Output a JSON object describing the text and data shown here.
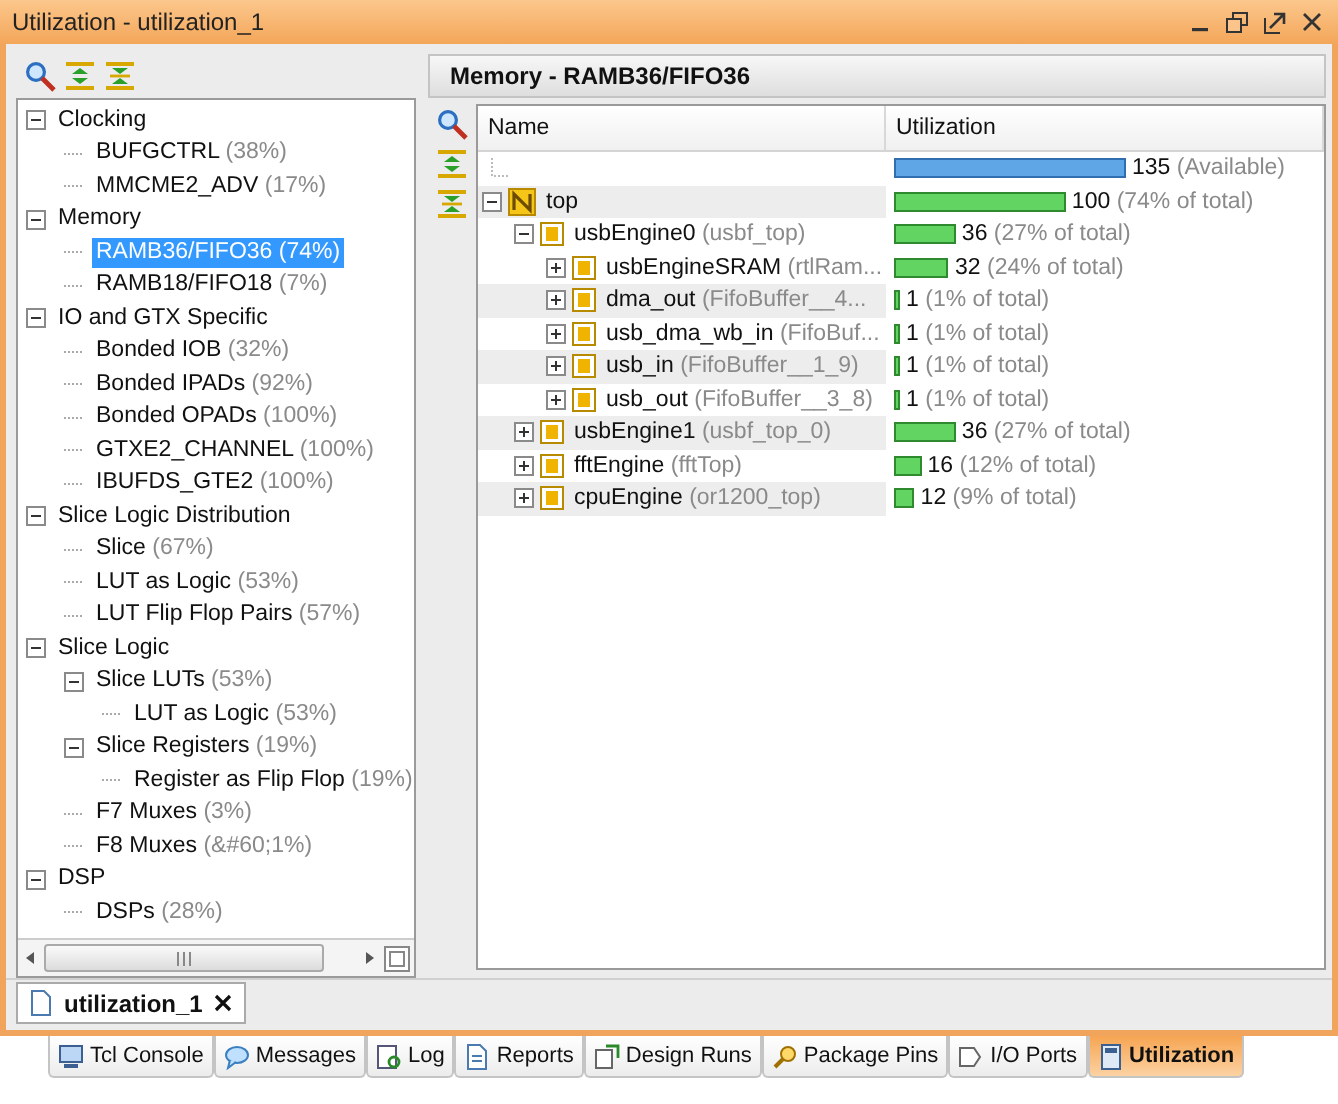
{
  "window": {
    "title": "Utilization - utilization_1"
  },
  "tree": [
    {
      "label": "Clocking",
      "selected": false,
      "expanded": true,
      "children": [
        {
          "label": "BUFGCTRL",
          "detail": "(38%)",
          "selected": false
        },
        {
          "label": "MMCME2_ADV",
          "detail": "(17%)",
          "selected": false
        }
      ]
    },
    {
      "label": "Memory",
      "selected": false,
      "expanded": true,
      "children": [
        {
          "label": "RAMB36/FIFO36",
          "detail": "(74%)",
          "selected": true
        },
        {
          "label": "RAMB18/FIFO18",
          "detail": "(7%)",
          "selected": false
        }
      ]
    },
    {
      "label": "IO and GTX Specific",
      "selected": false,
      "expanded": true,
      "children": [
        {
          "label": "Bonded IOB",
          "detail": "(32%)",
          "selected": false
        },
        {
          "label": "Bonded IPADs",
          "detail": "(92%)",
          "selected": false
        },
        {
          "label": "Bonded OPADs",
          "detail": "(100%)",
          "selected": false
        },
        {
          "label": "GTXE2_CHANNEL",
          "detail": "(100%)",
          "selected": false
        },
        {
          "label": "IBUFDS_GTE2",
          "detail": "(100%)",
          "selected": false
        }
      ]
    },
    {
      "label": "Slice Logic Distribution",
      "selected": false,
      "expanded": true,
      "children": [
        {
          "label": "Slice",
          "detail": "(67%)",
          "selected": false
        },
        {
          "label": "LUT as Logic",
          "detail": "(53%)",
          "selected": false
        },
        {
          "label": "LUT Flip Flop Pairs",
          "detail": "(57%)",
          "selected": false
        }
      ]
    },
    {
      "label": "Slice Logic",
      "selected": false,
      "expanded": true,
      "children": [
        {
          "label": "Slice LUTs",
          "detail": "(53%)",
          "selected": false,
          "expanded": true,
          "children": [
            {
              "label": "LUT as Logic",
              "detail": "(53%)",
              "selected": false
            }
          ]
        },
        {
          "label": "Slice Registers",
          "detail": "(19%)",
          "selected": false,
          "expanded": true,
          "children": [
            {
              "label": "Register as Flip Flop",
              "detail": "(19%)",
              "selected": false
            }
          ]
        },
        {
          "label": "F7 Muxes",
          "detail": "(3%)",
          "selected": false
        },
        {
          "label": "F8 Muxes",
          "detail": "(&#60;1%)",
          "selected": false
        }
      ]
    },
    {
      "label": "DSP",
      "selected": false,
      "expanded": true,
      "children": [
        {
          "label": "DSPs",
          "detail": "(28%)",
          "selected": false
        }
      ]
    }
  ],
  "panel": {
    "title": "Memory - RAMB36/FIFO36"
  },
  "table": {
    "columns": [
      "Name",
      "Utilization"
    ],
    "rows": [
      {
        "kind": "available",
        "value": "135",
        "note": "(Available)",
        "color": "#5ea6e6"
      },
      {
        "kind": "top",
        "name": "top",
        "expanded": true,
        "value": "100",
        "note": "(74% of total)",
        "color": "#62d462",
        "children": [
          {
            "kind": "module",
            "name": "usbEngine0",
            "detail": "(usbf_top)",
            "expanded": true,
            "value": "36",
            "note": "(27% of total)",
            "color": "#62d462",
            "children": [
              {
                "kind": "module",
                "name": "usbEngineSRAM",
                "detail": "(rtlRam...",
                "expanded": false,
                "value": "32",
                "note": "(24% of total)",
                "color": "#62d462"
              },
              {
                "kind": "module",
                "name": "dma_out",
                "detail": "(FifoBuffer__4...",
                "expanded": false,
                "value": "1",
                "note": "(1% of total)",
                "color": "#62d462"
              },
              {
                "kind": "module",
                "name": "usb_dma_wb_in",
                "detail": "(FifoBuf...",
                "expanded": false,
                "value": "1",
                "note": "(1% of total)",
                "color": "#62d462"
              },
              {
                "kind": "module",
                "name": "usb_in",
                "detail": "(FifoBuffer__1_9)",
                "expanded": false,
                "value": "1",
                "note": "(1% of total)",
                "color": "#62d462"
              },
              {
                "kind": "module",
                "name": "usb_out",
                "detail": "(FifoBuffer__3_8)",
                "expanded": false,
                "value": "1",
                "note": "(1% of total)",
                "color": "#62d462"
              }
            ]
          },
          {
            "kind": "module",
            "name": "usbEngine1",
            "detail": "(usbf_top_0)",
            "expanded": false,
            "value": "36",
            "note": "(27% of total)",
            "color": "#62d462"
          },
          {
            "kind": "module",
            "name": "fftEngine",
            "detail": "(fftTop)",
            "expanded": false,
            "value": "16",
            "note": "(12% of total)",
            "color": "#62d462"
          },
          {
            "kind": "module",
            "name": "cpuEngine",
            "detail": "(or1200_top)",
            "expanded": false,
            "value": "12",
            "note": "(9% of total)",
            "color": "#62d462"
          }
        ]
      }
    ]
  },
  "doc_tabs": [
    {
      "label": "utilization_1",
      "selected": true
    }
  ],
  "bottom_tabs": [
    {
      "label": "Tcl Console",
      "kind": "console",
      "selected": false
    },
    {
      "label": "Messages",
      "kind": "messages",
      "selected": false
    },
    {
      "label": "Log",
      "kind": "log",
      "selected": false
    },
    {
      "label": "Reports",
      "kind": "reports",
      "selected": false
    },
    {
      "label": "Design Runs",
      "kind": "runs",
      "selected": false
    },
    {
      "label": "Package Pins",
      "kind": "pins",
      "selected": false
    },
    {
      "label": "I/O Ports",
      "kind": "ports",
      "selected": false
    },
    {
      "label": "Utilization",
      "kind": "utilization",
      "selected": true
    }
  ]
}
